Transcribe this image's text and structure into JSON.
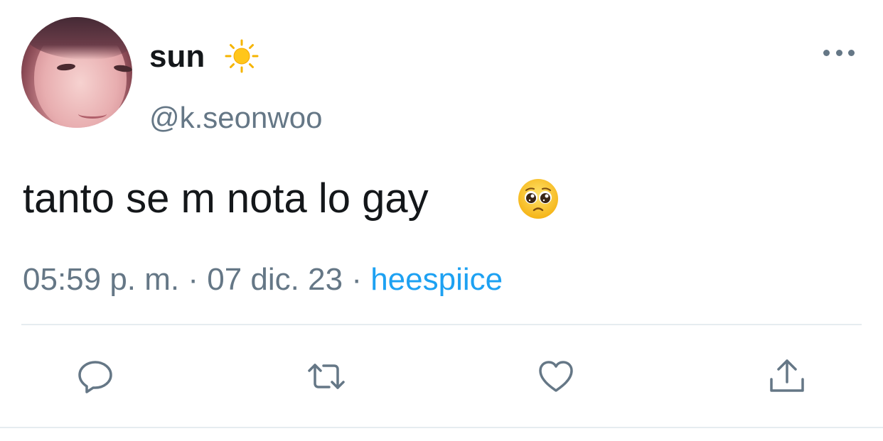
{
  "tweet": {
    "display_name": "sun",
    "name_emoji": "sun-icon",
    "handle": "@k.seonwoo",
    "text": "tanto se m nota lo gay",
    "text_emoji": "pleading-face-icon",
    "time": "05:59 p. m.",
    "date": "07 dic. 23",
    "separator": "·",
    "source": "heespiice"
  },
  "actions": {
    "reply": "reply-icon",
    "retweet": "retweet-icon",
    "like": "heart-icon",
    "share": "share-icon"
  },
  "colors": {
    "text": "#14171a",
    "secondary": "#657786",
    "accent": "#1da1f2",
    "divider": "#e6ecf0"
  }
}
